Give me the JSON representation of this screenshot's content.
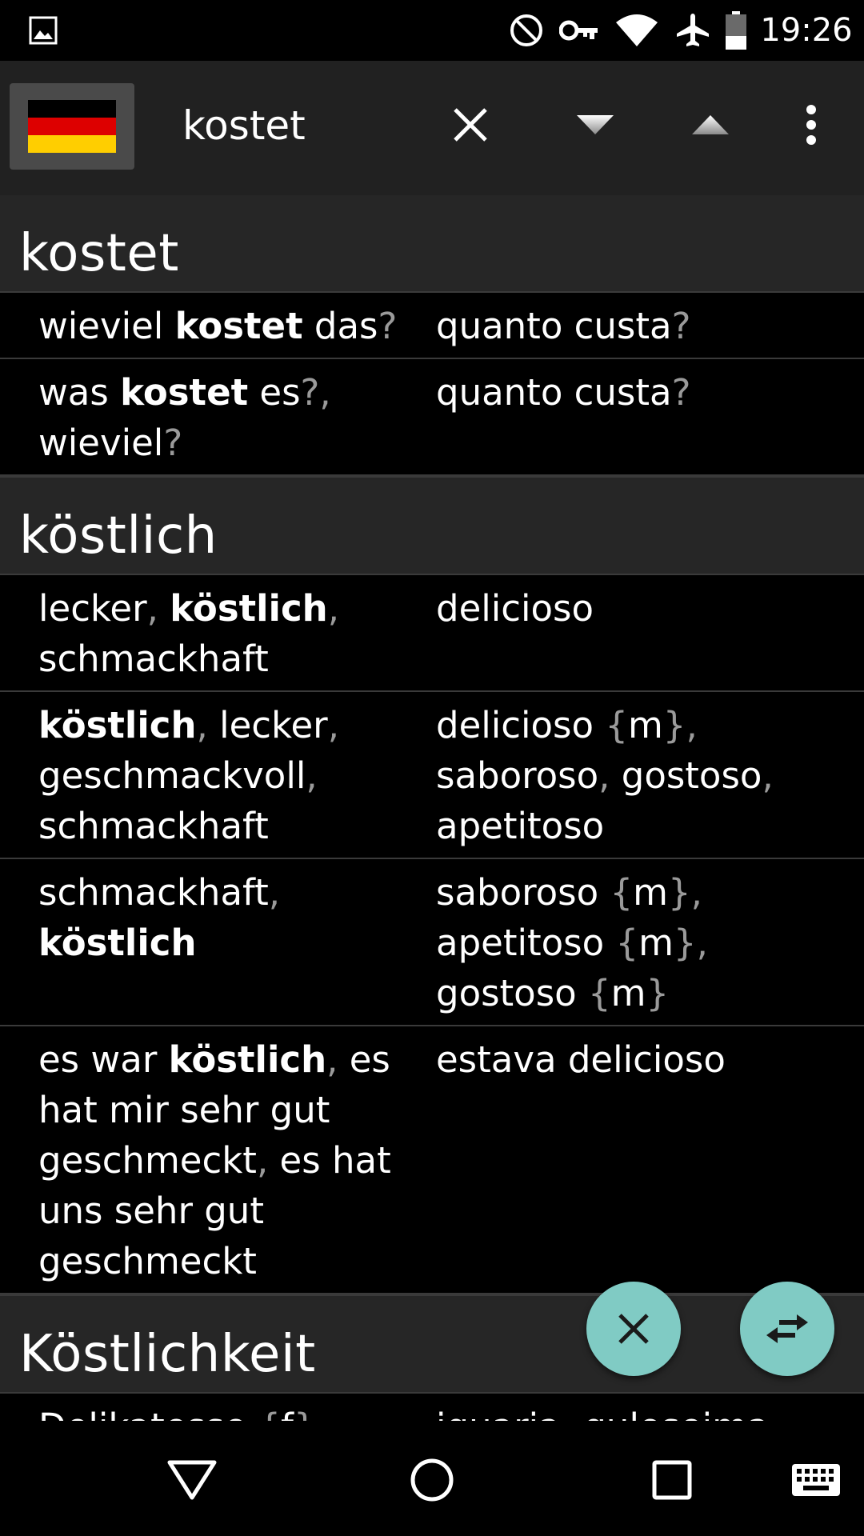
{
  "status_bar": {
    "time": "19:26",
    "icons": [
      "image-icon",
      "do-not-disturb-icon",
      "vpn-key-icon",
      "wifi-icon",
      "airplane-icon",
      "battery-icon"
    ]
  },
  "toolbar": {
    "language_flag": "germany",
    "flag_colors": [
      "#000000",
      "#DD0000",
      "#FFCE00"
    ],
    "search_value": "kostet",
    "icons": [
      "clear-icon",
      "arrow-down-icon",
      "arrow-up-icon",
      "more-vert-icon"
    ]
  },
  "entries": [
    {
      "headword": "kostet",
      "rows": [
        {
          "left": [
            [
              "wieviel ",
              ""
            ],
            [
              "kostet",
              "b"
            ],
            [
              " das",
              ""
            ],
            [
              "?",
              "g"
            ]
          ],
          "right": [
            [
              "quanto custa",
              ""
            ],
            [
              "?",
              "g"
            ]
          ]
        },
        {
          "left": [
            [
              "was ",
              ""
            ],
            [
              "kostet",
              "b"
            ],
            [
              " es",
              ""
            ],
            [
              "?,",
              "g"
            ],
            [
              "\nwieviel",
              ""
            ],
            [
              "?",
              "g"
            ]
          ],
          "right": [
            [
              "quanto custa",
              ""
            ],
            [
              "?",
              "g"
            ]
          ]
        }
      ]
    },
    {
      "headword": "köstlich",
      "rows": [
        {
          "left": [
            [
              "lecker",
              ""
            ],
            [
              ", ",
              "g"
            ],
            [
              "köstlich",
              "b"
            ],
            [
              ",",
              "g"
            ],
            [
              "\nschmackhaft",
              ""
            ]
          ],
          "right": [
            [
              "delicioso",
              ""
            ]
          ]
        },
        {
          "left": [
            [
              "köstlich",
              "b"
            ],
            [
              ", ",
              "g"
            ],
            [
              "lecker",
              ""
            ],
            [
              ",",
              "g"
            ],
            [
              "\ngeschmackvoll",
              ""
            ],
            [
              ",",
              "g"
            ],
            [
              "\nschmackhaft",
              ""
            ]
          ],
          "right": [
            [
              "delicioso ",
              ""
            ],
            [
              "{",
              "g"
            ],
            [
              "m",
              ""
            ],
            [
              "}",
              "g"
            ],
            [
              ",",
              "g"
            ],
            [
              "\nsaboroso",
              ""
            ],
            [
              ", ",
              "g"
            ],
            [
              "gostoso",
              ""
            ],
            [
              ",",
              "g"
            ],
            [
              "\napetitoso",
              ""
            ]
          ]
        },
        {
          "left": [
            [
              "schmackhaft",
              ""
            ],
            [
              ",",
              "g"
            ],
            [
              "\n",
              ""
            ],
            [
              "köstlich",
              "b"
            ]
          ],
          "right": [
            [
              "saboroso ",
              ""
            ],
            [
              "{",
              "g"
            ],
            [
              "m",
              ""
            ],
            [
              "}",
              "g"
            ],
            [
              ",",
              "g"
            ],
            [
              "\napetitoso ",
              ""
            ],
            [
              "{",
              "g"
            ],
            [
              "m",
              ""
            ],
            [
              "}",
              "g"
            ],
            [
              ",",
              "g"
            ],
            [
              "\ngostoso ",
              ""
            ],
            [
              "{",
              "g"
            ],
            [
              "m",
              ""
            ],
            [
              "}",
              "g"
            ]
          ]
        },
        {
          "left": [
            [
              "es war ",
              ""
            ],
            [
              "köstlich",
              "b"
            ],
            [
              ", ",
              "g"
            ],
            [
              "es\nhat mir sehr gut\ngeschmeckt",
              ""
            ],
            [
              ", ",
              "g"
            ],
            [
              "es hat\nuns sehr gut\ngeschmeckt",
              ""
            ]
          ],
          "right": [
            [
              "estava delicioso",
              ""
            ]
          ]
        }
      ]
    },
    {
      "headword": "Köstlichkeit",
      "rows": [
        {
          "left": [
            [
              "Delikatesse ",
              ""
            ],
            [
              "{",
              "g"
            ],
            [
              "f",
              ""
            ],
            [
              "}",
              "g"
            ],
            [
              ",",
              "g"
            ]
          ],
          "right": [
            [
              "iguaria",
              ""
            ],
            [
              ", ",
              "g"
            ],
            [
              "guloseima",
              ""
            ]
          ]
        }
      ]
    }
  ],
  "fabs": {
    "clear_icon": "close-icon",
    "swap_icon": "swap-horiz-icon",
    "color": "#80CBC4"
  },
  "nav_bar": {
    "icons": [
      "back-icon",
      "home-icon",
      "recents-icon",
      "keyboard-icon"
    ]
  }
}
